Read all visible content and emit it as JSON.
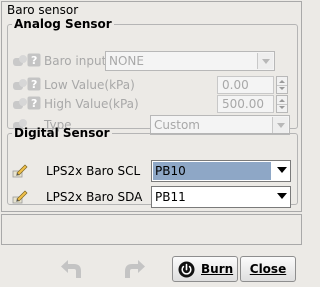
{
  "panel_title": "Baro sensor",
  "analog": {
    "legend": "Analog Sensor",
    "baro_input": {
      "label": "Baro input",
      "value": "NONE"
    },
    "low_value": {
      "label": "Low Value(kPa)",
      "value": "0.00"
    },
    "high_value": {
      "label": "High Value(kPa)",
      "value": "500.00"
    },
    "type": {
      "label": "Type",
      "value": "Custom"
    }
  },
  "digital": {
    "legend": "Digital Sensor",
    "scl": {
      "label": "LPS2x Baro SCL",
      "value": "PB10"
    },
    "sda": {
      "label": "LPS2x Baro SDA",
      "value": "PB11"
    }
  },
  "buttons": {
    "burn": "Burn",
    "close": "Close"
  },
  "icons": [
    "toggle-icon",
    "help-icon",
    "edit-pencil-icon",
    "undo-icon",
    "redo-icon",
    "power-icon"
  ],
  "colors": {
    "selected_highlight": "#8ea7c6",
    "background": "#eceae6"
  }
}
